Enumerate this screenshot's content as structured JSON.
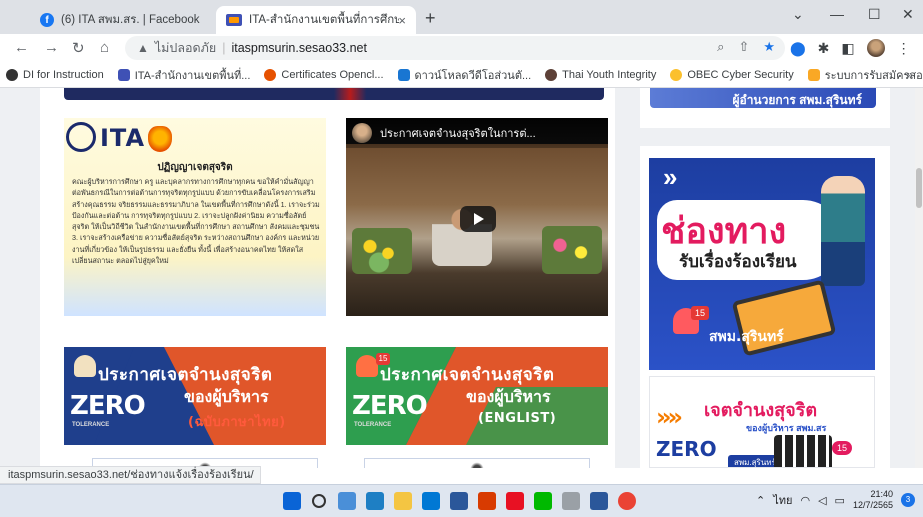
{
  "tabs": [
    {
      "title": "(6) ITA สพม.สร. | Facebook",
      "close": "×"
    },
    {
      "title": "ITA-สำนักงานเขตพื้นที่การศึกษามัธยม",
      "close": "×"
    }
  ],
  "new_tab": "+",
  "window_controls": {
    "dropdown": "⌄",
    "minimize": "—",
    "maximize": "☐",
    "close": "✕"
  },
  "nav": {
    "back": "←",
    "forward": "→",
    "reload": "↻",
    "home": "⌂"
  },
  "address": {
    "security_label": "ไม่ปลอดภัย",
    "url": "itaspmsurin.sesao33.net"
  },
  "bookmarks": [
    {
      "label": "DI for Instruction",
      "color": "#333333"
    },
    {
      "label": "ITA-สำนักงานเขตพื้นที่...",
      "color": "#3f51b5"
    },
    {
      "label": "Certificates Opencl...",
      "color": "#e65100"
    },
    {
      "label": "ดาวน์โหลดวีดีโอส่วนตั...",
      "color": "#1976d2"
    },
    {
      "label": "Thai Youth Integrity",
      "color": "#5d4037"
    },
    {
      "label": "OBEC Cyber Security",
      "color": "#fbc02d"
    },
    {
      "label": "ระบบการรับสมัครสอบ...",
      "color": "#f9a825"
    }
  ],
  "bookmarks_more": "»",
  "sidebar_top": {
    "text": "ผู้อำนวยการ สพม.สุรินทร์"
  },
  "declaration": {
    "logo": "ITA",
    "title": "ปฏิญญาเจตสุจริต",
    "body": "คณะผู้บริหารการศึกษา ครู และบุคลากรทางการศึกษาทุกคน ขอให้คำมั่นสัญญาต่อพันธกรณีในการต่อต้านการทุจริตทุกรูปแบบ ด้วยการขับเคลื่อนโครงการเสริมสร้างคุณธรรม จริยธรรมและธรรมาภิบาล ในเขตพื้นที่การศึกษาดังนี้ 1. เราจะร่วมป้องกันและต่อต้าน การทุจริตทุกรูปแบบ 2. เราจะปลูกฝังค่านิยม ความซื่อสัตย์สุจริต ให้เป็นวิถีชีวิต ในสำนักงานเขตพื้นที่การศึกษา สถานศึกษา สังคมและชุมชน 3. เราจะสร้างเครือข่าย ความซื่อสัตย์สุจริต ระหว่างสถานศึกษา องค์กร และหน่วยงานที่เกี่ยวข้อง ให้เป็นรูปธรรม และยั่งยืน ทั้งนี้ เพื่อสร้างอนาคตไทย ให้สดใสเปลี่ยนสถานะ ตลอดไปสู่ยุคใหม่"
  },
  "video": {
    "title": "ประกาศเจตจำนงสุจริตในการต่..."
  },
  "banner1": {
    "line1": "ประกาศเจตจำนงสุจริต",
    "line2": "ของผู้บริหาร",
    "line3": "(ฉบับภาษาไทย)",
    "zero": "ZERO",
    "zero_sub": "TOLERANCE"
  },
  "banner2": {
    "line1": "ประกาศเจตจำนงสุจริต",
    "line2": "ของผู้บริหาร",
    "line3": "(ENGLIST)",
    "zero": "ZERO",
    "zero_sub": "TOLERANCE",
    "badge": "15"
  },
  "channel_card": {
    "big": "ช่องทาง",
    "sub": "รับเรื่องร้องเรียน",
    "label": "สพม.สุรินทร์",
    "badge": "15"
  },
  "zero_card": {
    "line1": "เจตจำนงสุจริต",
    "line2": "ของผู้บริหาร สพม.สร",
    "zero": "ZERO",
    "label": "สพม.สุรินทร์",
    "badge": "15"
  },
  "status_url": "itaspmsurin.sesao33.net/ช่องทางแจ้งเรื่องร้องเรียน/",
  "tray": {
    "ime": "ไทย",
    "time": "21:40",
    "date": "12/7/2565",
    "notifications": "3"
  }
}
